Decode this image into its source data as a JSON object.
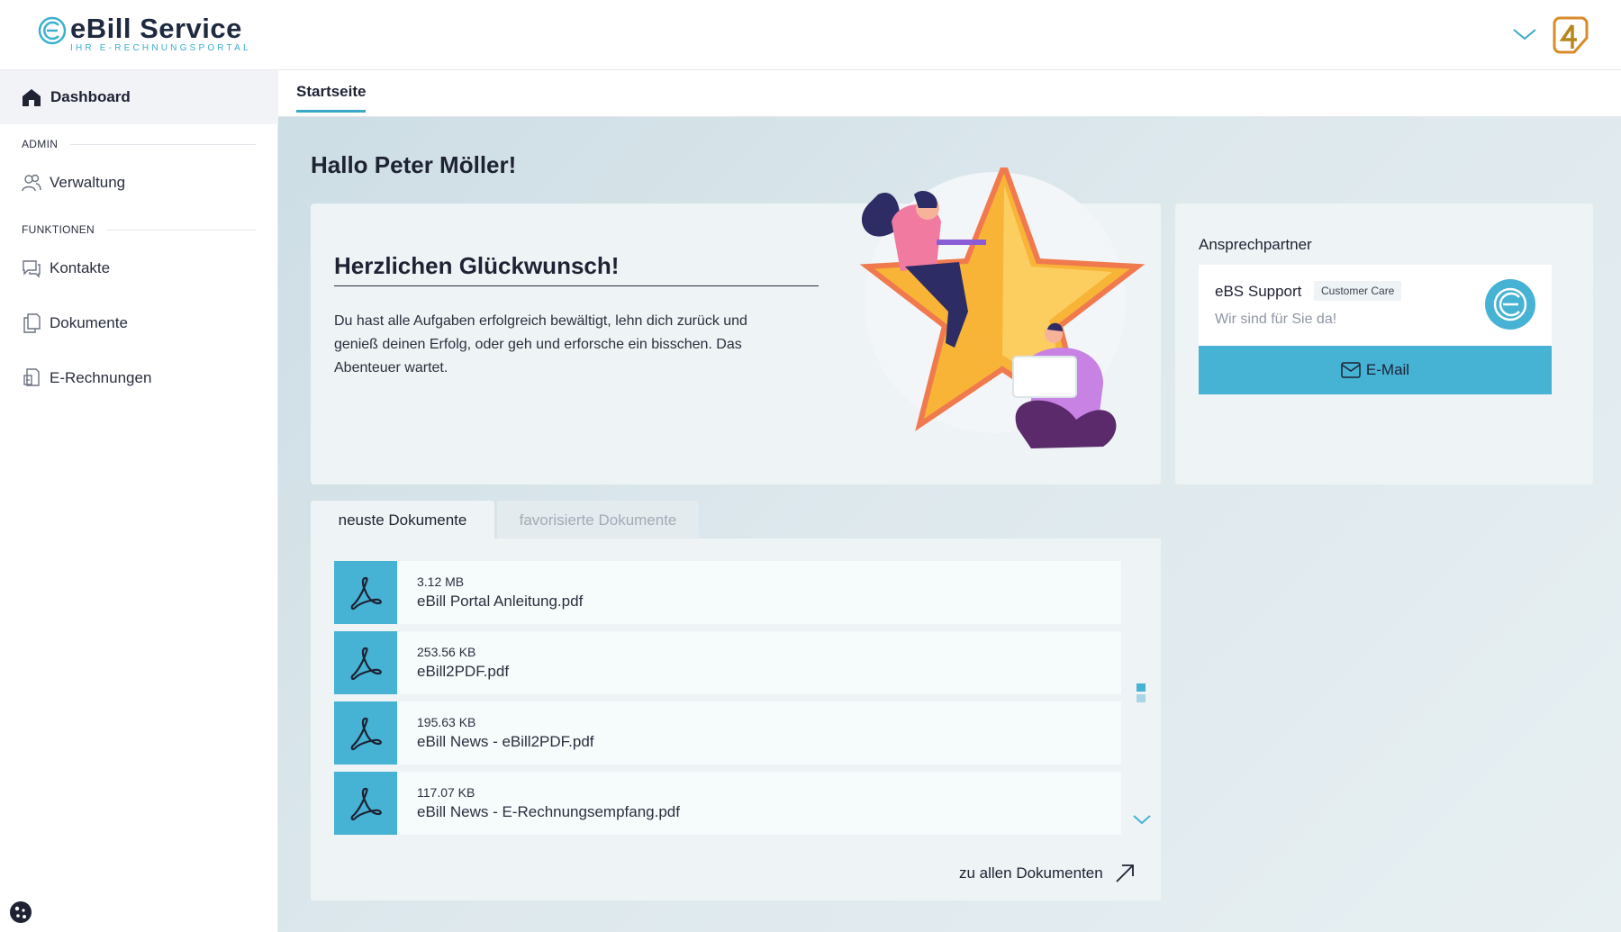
{
  "app": {
    "logo_title": "eBill Service",
    "logo_subtitle": "IHR E-RECHNUNGSPORTAL",
    "brand_accent": "#3aa8c9"
  },
  "sidebar": {
    "active": {
      "label": "Dashboard",
      "icon": "home-icon"
    },
    "sections": [
      {
        "title": "ADMIN",
        "items": [
          {
            "label": "Verwaltung",
            "icon": "users-icon"
          }
        ]
      },
      {
        "title": "FUNKTIONEN",
        "items": [
          {
            "label": "Kontakte",
            "icon": "chat-icon"
          },
          {
            "label": "Dokumente",
            "icon": "documents-icon"
          },
          {
            "label": "E-Rechnungen",
            "icon": "invoice-icon"
          }
        ]
      }
    ]
  },
  "tabs": {
    "start": "Startseite"
  },
  "greeting": "Hallo Peter Möller!",
  "welcome": {
    "title": "Herzlichen Glückwunsch!",
    "text": "Du hast alle Aufgaben erfolgreich bewältigt, lehn dich zurück und genieß deinen Erfolg, oder geh und erforsche ein bisschen. Das Abenteuer wartet."
  },
  "contact": {
    "heading": "Ansprechpartner",
    "name": "eBS Support",
    "badge": "Customer Care",
    "subtitle": "Wir sind für Sie da!",
    "button": "E-Mail"
  },
  "documents": {
    "tab_recent": "neuste Dokumente",
    "tab_favorites": "favorisierte Dokumente",
    "items": [
      {
        "size": "3.12 MB",
        "name": "eBill Portal Anleitung.pdf"
      },
      {
        "size": "253.56 KB",
        "name": "eBill2PDF.pdf"
      },
      {
        "size": "195.63 KB",
        "name": "eBill News - eBill2PDF.pdf"
      },
      {
        "size": "117.07 KB",
        "name": "eBill News - E-Rechnungsempfang.pdf"
      }
    ],
    "all_link": "zu allen Dokumenten"
  }
}
